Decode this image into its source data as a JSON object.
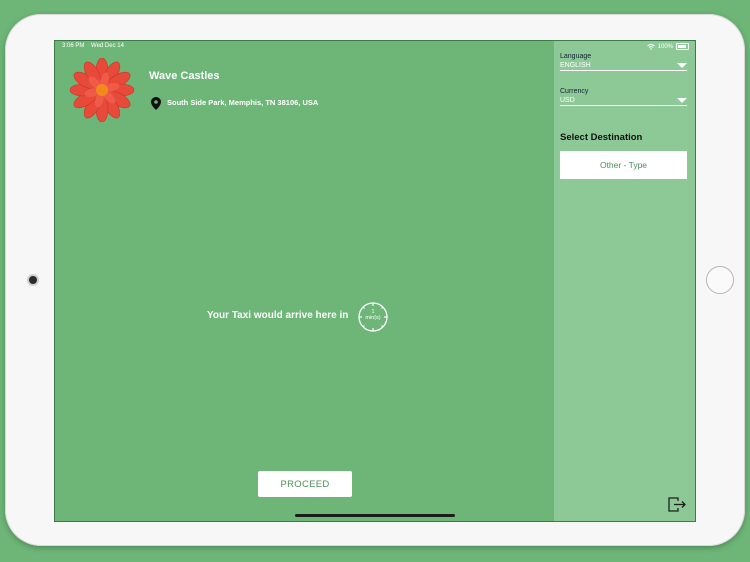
{
  "status_bar": {
    "time": "3:06 PM",
    "date": "Wed Dec 14",
    "battery": "100%"
  },
  "venue": {
    "name": "Wave Castles",
    "address": "South Side Park, Memphis, TN 38106, USA"
  },
  "taxi": {
    "message": "Your Taxi would arrive here in",
    "eta_value": "1",
    "eta_unit": "min(s)"
  },
  "actions": {
    "proceed_label": "PROCEED"
  },
  "settings": {
    "language_label": "Language",
    "language_value": "ENGLISH",
    "currency_label": "Currency",
    "currency_value": "USD"
  },
  "destination": {
    "title": "Select Destination",
    "option_label": "Other - Type"
  },
  "colors": {
    "background": "#6db677",
    "panel": "#8dc996",
    "accent_text": "#4b8f57"
  },
  "icons": [
    "flower-logo",
    "location-pin-icon",
    "clock-icon",
    "chevron-down-icon",
    "logout-icon",
    "wifi-icon",
    "battery-icon"
  ]
}
